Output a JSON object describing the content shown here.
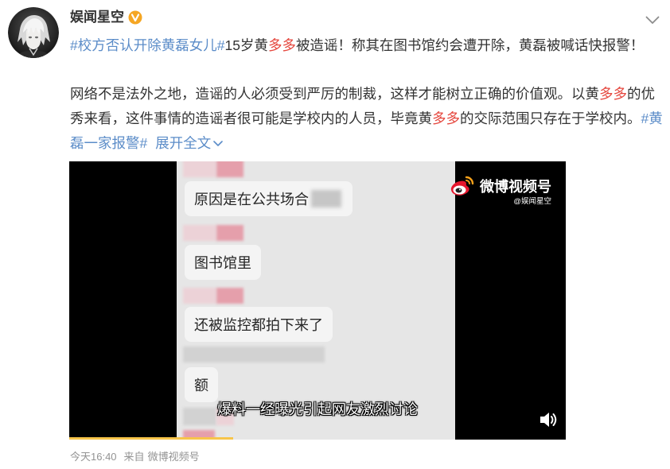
{
  "post": {
    "author": {
      "name": "娱闻星空",
      "avatar_icon": "avatar-image",
      "verified_icon": "verified-v-icon"
    },
    "menu_icon": "chevron-down-icon",
    "headline": {
      "topic": "#校方否认开除黄磊女儿#",
      "text_1": "15岁黄",
      "keyword": "多多",
      "text_2": "被造谣！称其在图书馆约会遭开除，黄磊被喊话快报警！"
    },
    "body_lines": [
      {
        "text_1": "网络不是法外之地，造谣的人必须受到严厉的制裁，这样才能树立正确的价值观。以黄",
        "keyword": "多多",
        "text_2": "的优"
      },
      {
        "text_1": "秀来看，这件事情的造谣者很可能是学校内的人员，毕竟黄",
        "keyword": "多多",
        "text_2": "的交际范围只存在于学校内。",
        "topic_part": "#黄"
      },
      {
        "topic_part": "磊一家报警#",
        "expand_label": "展开全文",
        "expand_icon": "chevron-down-icon"
      }
    ],
    "video": {
      "watermark_logo_icon": "weibo-logo-icon",
      "watermark_brand": "微博视频号",
      "watermark_handle": "@娱闻星空",
      "chat_messages": [
        "原因是在公共场合",
        "图书馆里",
        "还被监控都拍下来了",
        "额"
      ],
      "subtitle": "爆料一经曝光引起网友激烈讨论",
      "volume_icon": "speaker-icon",
      "progress": 0.33
    },
    "meta": {
      "time": "今天16:40",
      "source_prefix": "来自",
      "source": "微博视频号"
    }
  },
  "colors": {
    "text": "#333333",
    "link": "#5b8cc8",
    "keyword": "#e5463d",
    "meta": "#939393",
    "verified": "#f5a623",
    "progress": "#f7c54a",
    "video_bg": "#000000"
  }
}
